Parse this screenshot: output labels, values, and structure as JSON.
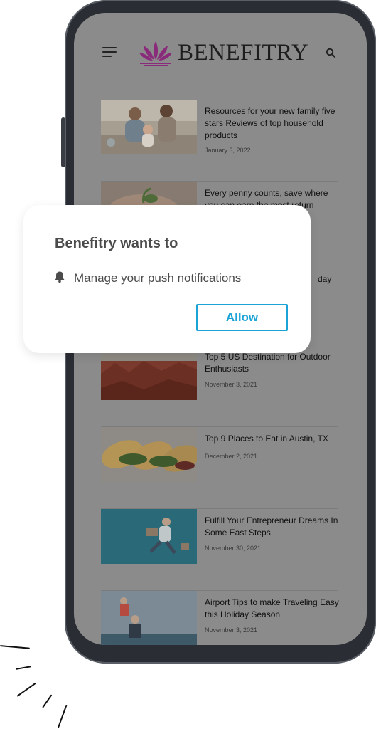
{
  "app": {
    "name": "BENEFITRY"
  },
  "articles": [
    {
      "title": "Resources for your new family five stars Reviews of top household products",
      "date": "January 3, 2022"
    },
    {
      "title": "Every penny counts, save where you can earn the most return",
      "date": ""
    },
    {
      "title": "day",
      "date": ""
    },
    {
      "title": "Top 5 US Destination for Outdoor Enthusiasts",
      "date": "November 3, 2021"
    },
    {
      "title": "Top 9 Places to Eat in Austin, TX",
      "date": "December 2, 2021"
    },
    {
      "title": "Fulfill Your Entrepreneur Dreams In Some East Steps",
      "date": "November 30, 2021"
    },
    {
      "title": "Airport Tips to make Traveling Easy this Holiday Season",
      "date": "November 3, 2021"
    }
  ],
  "dialog": {
    "title": "Benefitry wants to",
    "message": "Manage your push notifications",
    "allow_label": "Allow"
  },
  "colors": {
    "accent": "#1aa3d4",
    "logo": "#8a2a7a",
    "overlay": "#8b8b8b"
  },
  "icons": [
    "menu-icon",
    "search-icon",
    "bell-icon",
    "logo-lotus-icon"
  ]
}
